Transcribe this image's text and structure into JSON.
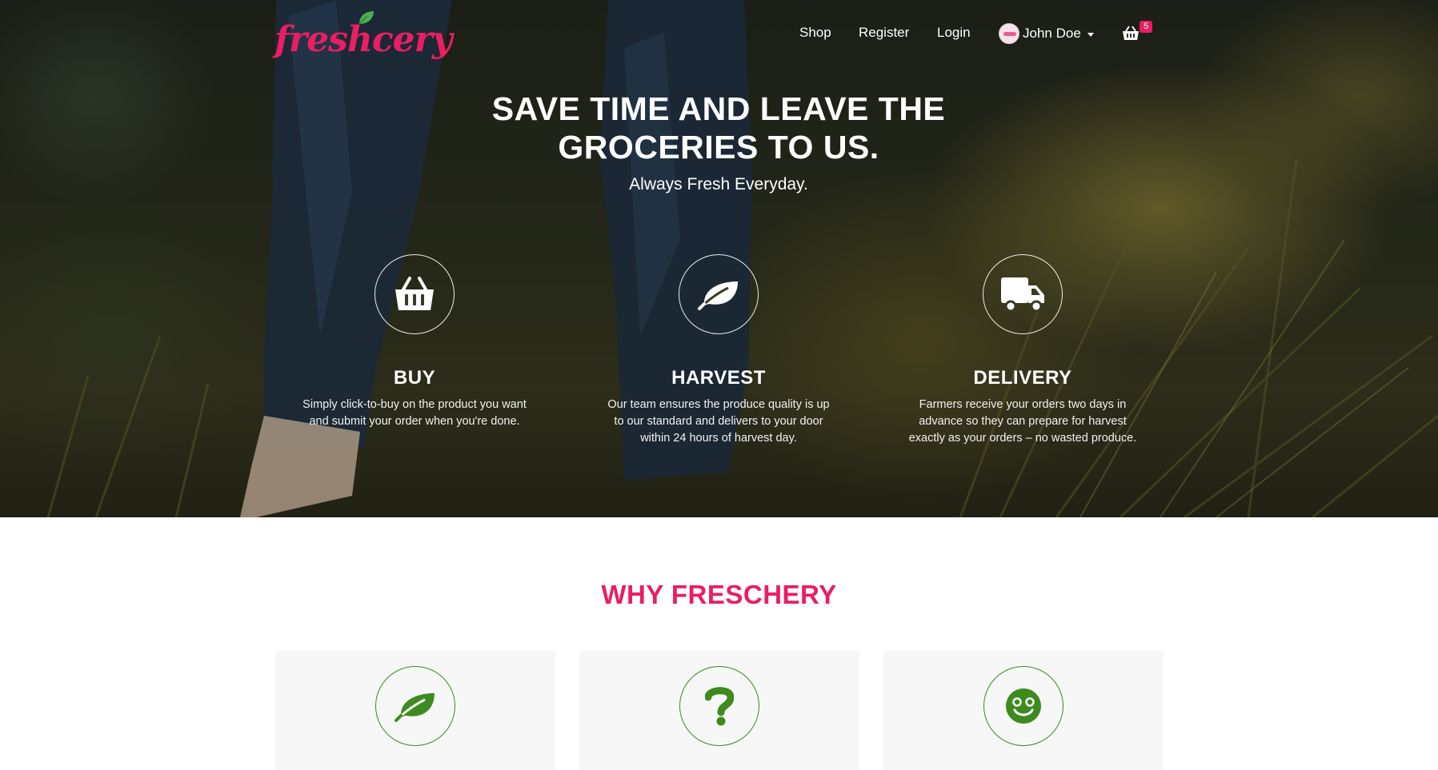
{
  "brand": {
    "name": "freshcery",
    "accent_color": "#e91e63",
    "green_color": "#3d8b1f"
  },
  "nav": {
    "links": [
      "Shop",
      "Register",
      "Login"
    ],
    "user_name": "John Doe",
    "cart_icon": "basket-icon",
    "cart_count": "5"
  },
  "hero": {
    "title": "SAVE TIME AND LEAVE THE GROCERIES TO US.",
    "subtitle": "Always Fresh Everyday.",
    "features": [
      {
        "icon": "basket-icon",
        "title": "BUY",
        "text": "Simply click-to-buy on the product you want and submit your order when you're done."
      },
      {
        "icon": "leaf-icon",
        "title": "HARVEST",
        "text": "Our team ensures the produce quality is up to our standard and delivers to your door within 24 hours of harvest day."
      },
      {
        "icon": "truck-icon",
        "title": "DELIVERY",
        "text": "Farmers receive your orders two days in advance so they can prepare for harvest exactly as your orders – no wasted produce."
      }
    ]
  },
  "why": {
    "title": "WHY FRESCHERY",
    "cards": [
      {
        "icon": "leaf-icon"
      },
      {
        "icon": "question-icon"
      },
      {
        "icon": "smiley-icon"
      }
    ]
  }
}
